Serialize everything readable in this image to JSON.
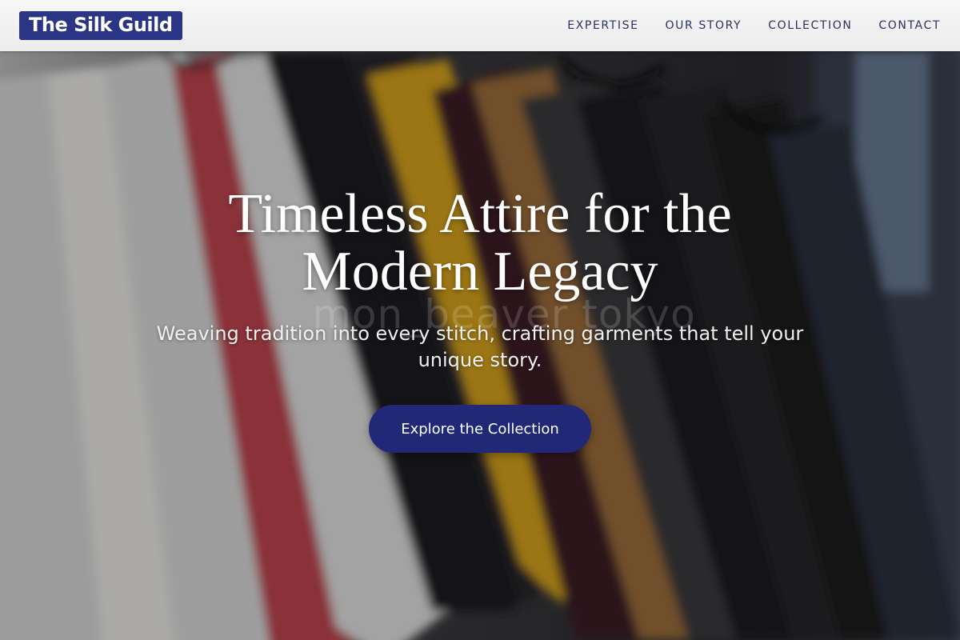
{
  "header": {
    "logo_text": "The Silk Guild",
    "nav": [
      {
        "label": "EXPERTISE"
      },
      {
        "label": "OUR STORY"
      },
      {
        "label": "COLLECTION"
      },
      {
        "label": "CONTACT"
      }
    ]
  },
  "hero": {
    "title_line1": "Timeless Attire for the",
    "title_line2": "Modern Legacy",
    "subtitle": "Weaving tradition into every stitch, crafting garments that tell your unique story.",
    "watermark": "mon_beaver tokyo",
    "cta_label": "Explore the Collection",
    "background_icon": "clothing-rack-photo"
  },
  "colors": {
    "brand": "#2b3586",
    "cta": "#212878",
    "nav_text": "#2a3160"
  }
}
